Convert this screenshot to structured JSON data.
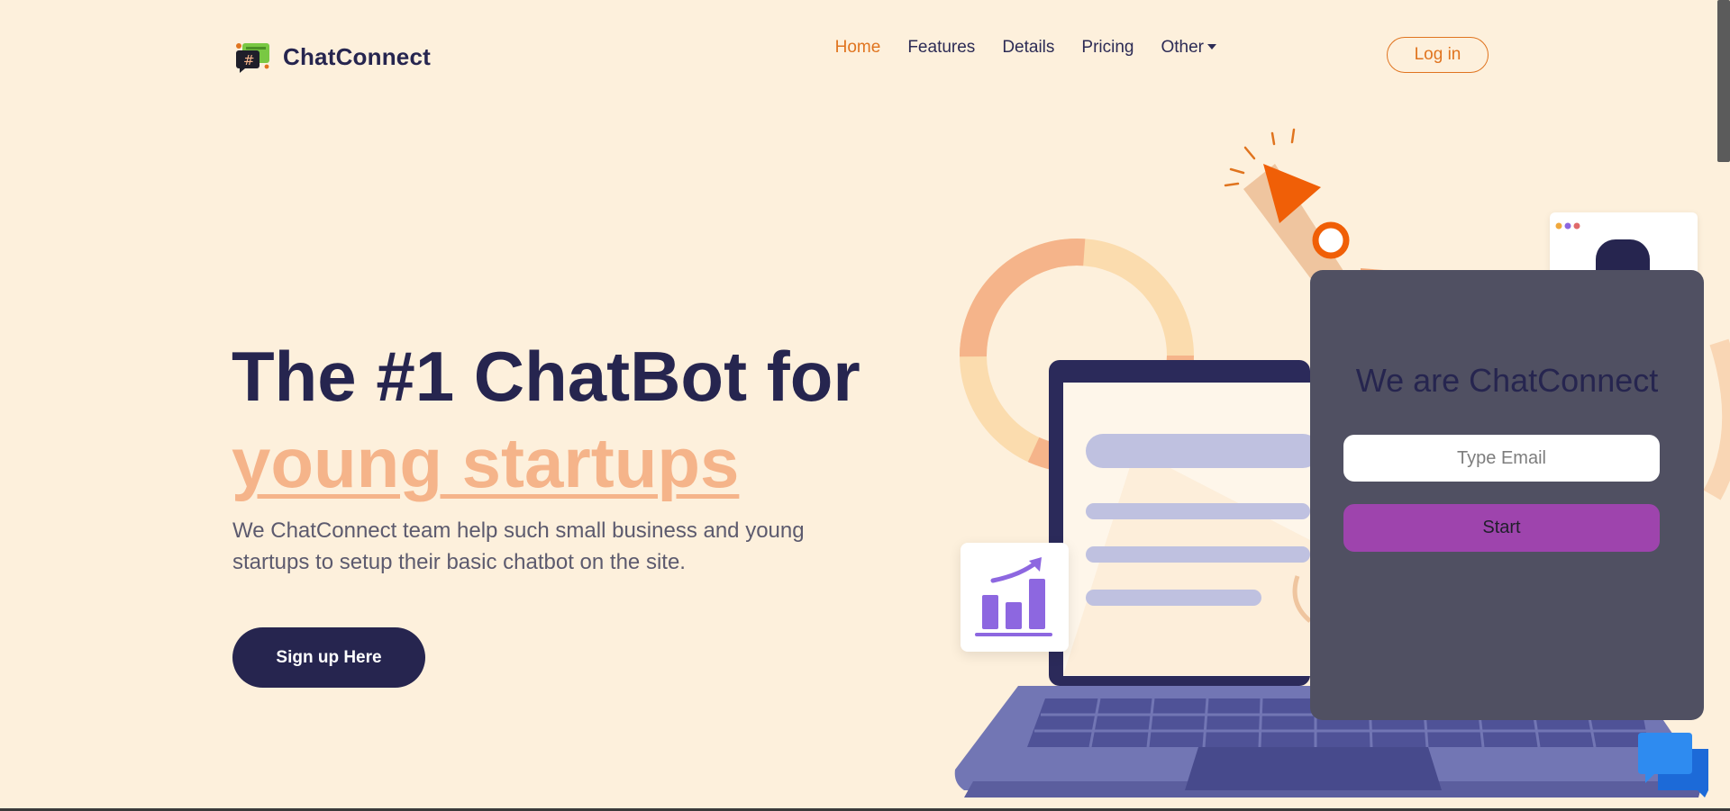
{
  "header": {
    "brand": "ChatConnect",
    "nav": [
      {
        "label": "Home",
        "active": true
      },
      {
        "label": "Features"
      },
      {
        "label": "Details"
      },
      {
        "label": "Pricing"
      },
      {
        "label": "Other",
        "dropdown": true
      }
    ],
    "login_label": "Log in"
  },
  "hero": {
    "title_line1": "The #1 ChatBot for",
    "title_line2": "young startups",
    "subtitle": "We ChatConnect team help such small business and young startups to setup their basic chatbot on the site.",
    "cta_label": "Sign up Here"
  },
  "panel": {
    "title": "We are ChatConnect",
    "email_placeholder": "Type Email",
    "start_label": "Start"
  },
  "icons": {
    "logo": "chat-bubbles-logo-icon",
    "chart": "growth-chart-icon",
    "rocket": "rocket-icon",
    "chat_fab": "chat-bubbles-icon"
  },
  "colors": {
    "background": "#fdf0dc",
    "primary": "#26254f",
    "accent_orange": "#e0741f",
    "highlight_peach": "#f5b48a",
    "panel_bg": "#505062",
    "start_button": "#9e44ad"
  }
}
